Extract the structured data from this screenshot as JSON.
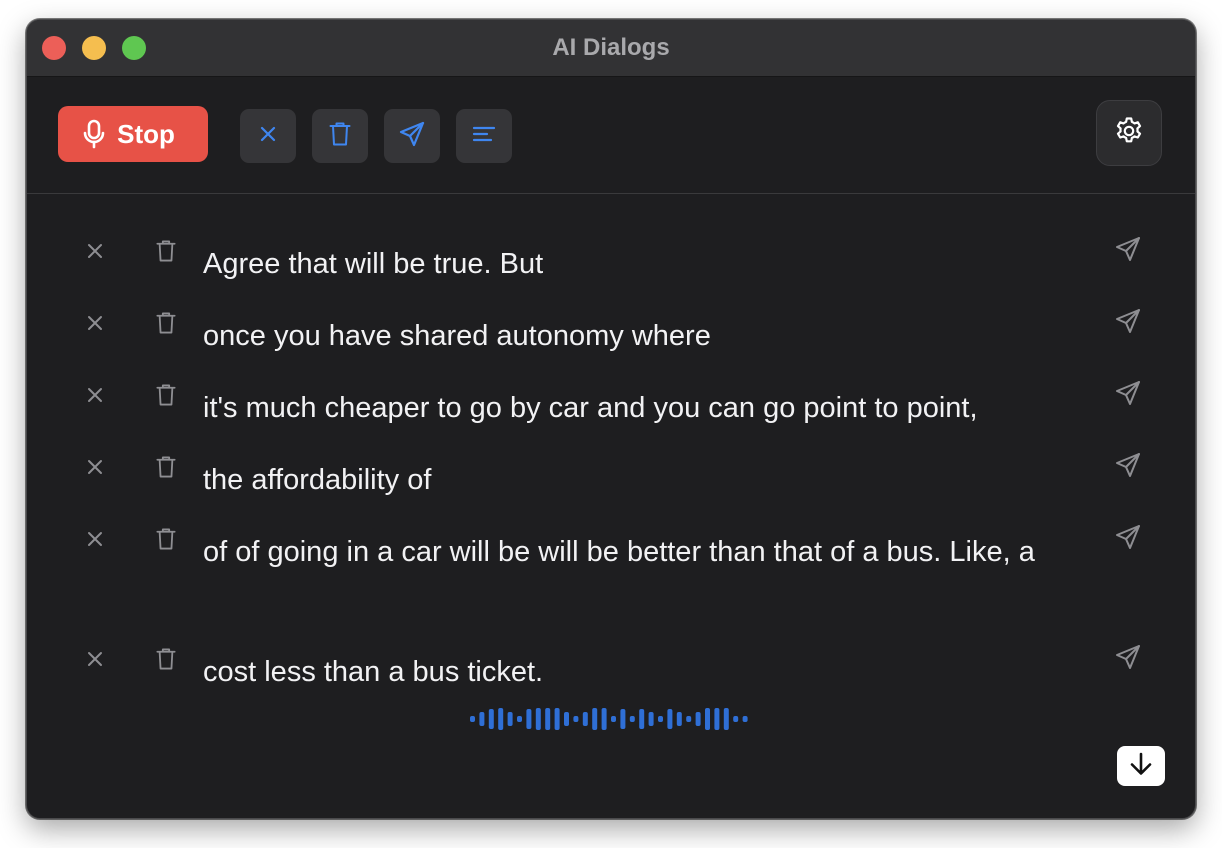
{
  "window": {
    "title": "AI Dialogs"
  },
  "toolbar": {
    "stop_label": "Stop",
    "icons": [
      "microphone-icon",
      "close-icon",
      "trash-icon",
      "send-icon",
      "align-left-icon",
      "gear-icon"
    ]
  },
  "transcript": {
    "lines": [
      {
        "text": "Agree that will be true. But"
      },
      {
        "text": "once you have shared autonomy where"
      },
      {
        "text": "it's much cheaper to go by car and you can go point to point,"
      },
      {
        "text": "the affordability of"
      },
      {
        "text": "of of going in a car will be will be better than that of a bus. Like, a"
      },
      {
        "text": "cost less than a bus ticket."
      }
    ],
    "row_icons": [
      "close-icon",
      "trash-icon",
      "send-icon"
    ]
  },
  "audio": {
    "icon": "audio-waveform-icon"
  },
  "scroll": {
    "icon": "arrow-down-icon"
  },
  "colors": {
    "stop": "#e75247",
    "accent": "#3f86f0",
    "waveform": "#2f6fd6"
  }
}
